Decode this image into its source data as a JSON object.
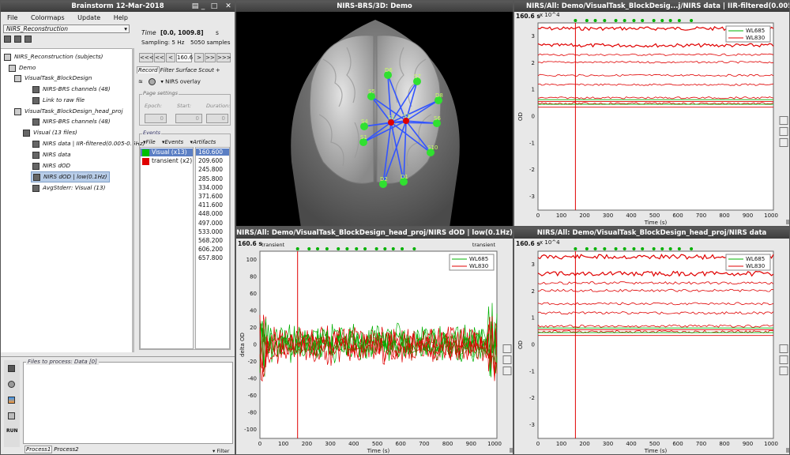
{
  "main_window": {
    "title": "Brainstorm 12-Mar-2018",
    "menu": [
      "File",
      "Colormaps",
      "Update",
      "Help"
    ],
    "protocol": "NIRS_Reconstruction",
    "tree": {
      "root": "NIRS_Reconstruction (subjects)",
      "subject": "Demo",
      "cond1": "VisualTask_BlockDesign",
      "cond1_items": [
        "NIRS-BRS channels (48)",
        "Link to raw file"
      ],
      "cond2": "VisualTask_BlockDesign_head_proj",
      "cond2_items": [
        "NIRS-BRS channels (48)",
        "Visual (13 files)",
        "NIRS data | IIR-filtered(0.005-0.5Hz)",
        "NIRS data",
        "NIRS dOD",
        "NIRS dOD | low(0.1Hz)",
        "AvgStderr: Visual (13)"
      ]
    },
    "time": {
      "label": "Time",
      "range": "[0.0, 1009.8]",
      "unit": "s",
      "sampling": "Sampling: 5 Hz",
      "samples": "5050 samples",
      "nav_buttons": [
        "<<<",
        "<<",
        "<",
        "160.6",
        ">",
        ">>",
        ">>>"
      ]
    },
    "tabs": [
      "Record",
      "Filter",
      "Surface",
      "Scout",
      "+"
    ],
    "overlay": "NIRS overlay",
    "page_settings": {
      "title": "Page settings",
      "epoch": "Epoch:",
      "start": "Start:",
      "duration": "Duration:",
      "epoch_val": "0",
      "start_val": "0",
      "duration_val": "0"
    },
    "events": {
      "title": "Events",
      "menus": [
        "File",
        "Events",
        "Artifacts"
      ],
      "groups": [
        {
          "label": "Visual (x13)",
          "color": "#00c000"
        },
        {
          "label": "transient (x2)",
          "color": "#e00000"
        }
      ],
      "times": [
        "160.600",
        "209.600",
        "245.800",
        "285.800",
        "334.000",
        "371.600",
        "411.600",
        "448.000",
        "497.000",
        "533.000",
        "568.200",
        "606.200",
        "657.800"
      ]
    },
    "process": {
      "title": "Files to process: Data [0]",
      "run": "RUN",
      "tabs": [
        "Process1",
        "Process2"
      ],
      "filter": "Filter"
    }
  },
  "win_3d": {
    "title": "NIRS-BRS/3D: Demo",
    "sensors": [
      "D6",
      "S7",
      "S5",
      "D8",
      "S4",
      "S6",
      "S2",
      "S3",
      "S1",
      "S10",
      "D2",
      "D1"
    ]
  },
  "win_tr": {
    "title": "NIRS/All: Demo/VisualTask_BlockDesig...j/NIRS data | IIR-filtered(0.005-0.5Hz)",
    "time": "160.6 s",
    "scale": "x 10^4",
    "ylabel": "OD",
    "xlabel": "Time (s)",
    "yticks": [
      "3",
      "2",
      "1",
      "0",
      "-1",
      "-2",
      "-3"
    ],
    "xticks": [
      "0",
      "100",
      "200",
      "300",
      "400",
      "500",
      "600",
      "700",
      "800",
      "900",
      "1000"
    ],
    "legend": [
      "WL685",
      "WL830"
    ]
  },
  "win_bl": {
    "title": "NIRS/All: Demo/VisualTask_BlockDesign_head_proj/NIRS dOD | low(0.1Hz)",
    "time": "160.6 s",
    "ylabel": "delta OD",
    "xlabel": "Time (s)",
    "yticks": [
      "100",
      "80",
      "60",
      "40",
      "20",
      "0",
      "-20",
      "-40",
      "-60",
      "-80",
      "-100"
    ],
    "xticks": [
      "0",
      "100",
      "200",
      "300",
      "400",
      "500",
      "600",
      "700",
      "800",
      "900",
      "1000"
    ],
    "legend": [
      "WL685",
      "WL830"
    ],
    "event_left": "transient",
    "event_right": "transient"
  },
  "win_br": {
    "title": "NIRS/All: Demo/VisualTask_BlockDesign_head_proj/NIRS data",
    "time": "160.6 s",
    "scale": "x 10^4",
    "ylabel": "OD",
    "xlabel": "Time (s)",
    "yticks": [
      "3",
      "2",
      "1",
      "0",
      "-1",
      "-2",
      "-3"
    ],
    "xticks": [
      "0",
      "100",
      "200",
      "300",
      "400",
      "500",
      "600",
      "700",
      "800",
      "900",
      "1000"
    ],
    "legend": [
      "WL685",
      "WL830"
    ]
  },
  "colors": {
    "green": "#00b000",
    "red": "#e00000",
    "accent": "#b8cde8"
  }
}
